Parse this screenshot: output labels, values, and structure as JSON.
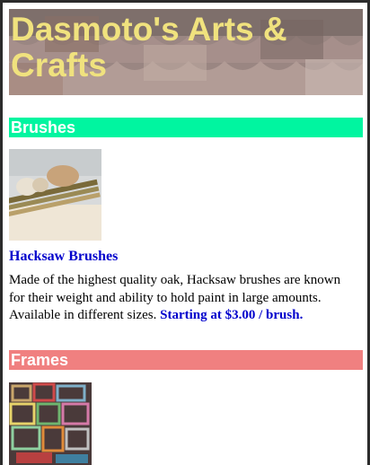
{
  "header": {
    "site_title": "Dasmoto's Arts & Crafts"
  },
  "sections": [
    {
      "heading": "Brushes",
      "heading_color": "#00f5a0",
      "product": {
        "title": "Hacksaw Brushes",
        "description": "Made of the highest quality oak, Hacksaw brushes are known for their weight and ability to hold paint in large amounts. Available in different sizes.",
        "price": "Starting at $3.00 / brush."
      }
    },
    {
      "heading": "Frames",
      "heading_color": "#f08080"
    }
  ],
  "colors": {
    "title_text": "#f0e27e",
    "product_link": "#0000cc"
  }
}
